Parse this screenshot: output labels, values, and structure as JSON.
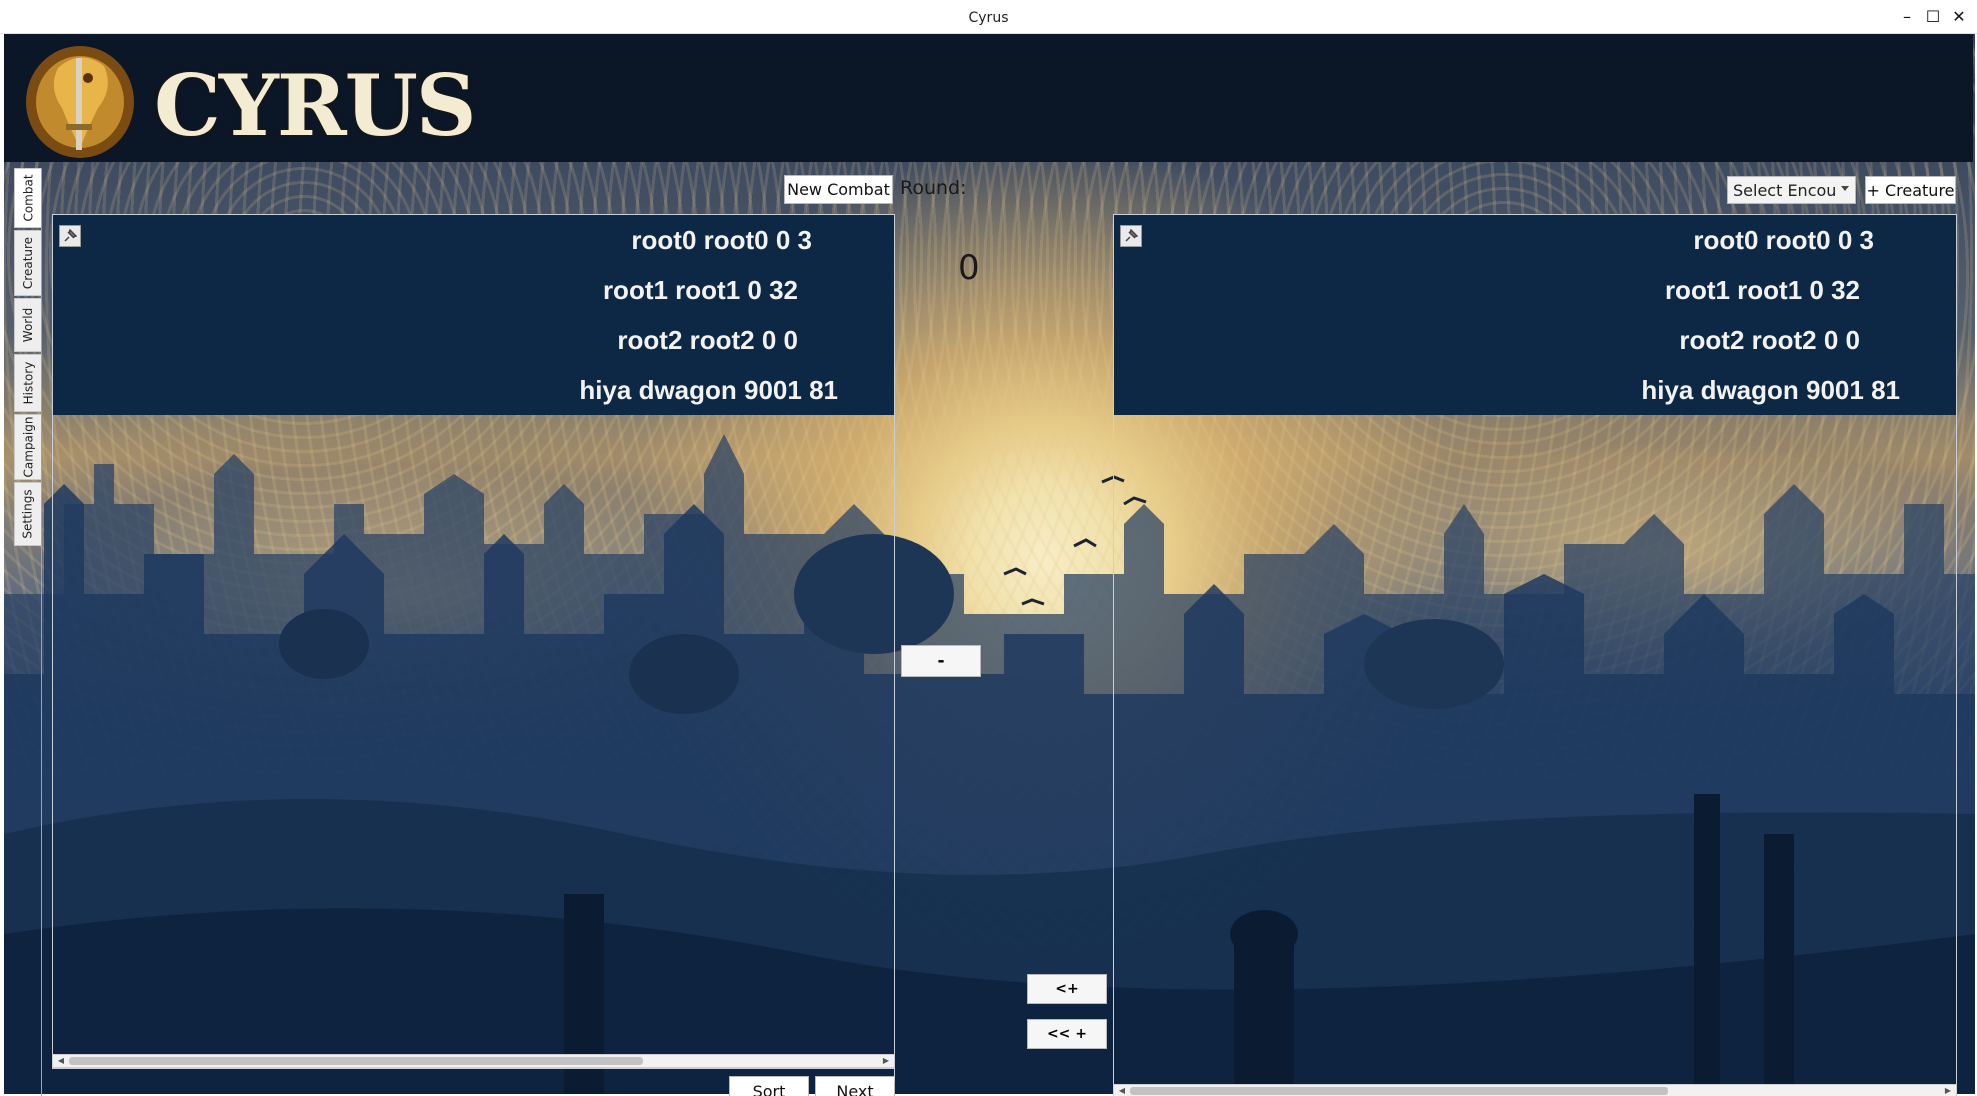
{
  "window": {
    "title": "Cyrus",
    "controls": {
      "minimize": "–",
      "maximize": "☐",
      "close": "✕"
    }
  },
  "header": {
    "logo_text": "CYRUS"
  },
  "sidebar": {
    "tabs": [
      {
        "label": "Combat",
        "active": true
      },
      {
        "label": "Creature",
        "active": false
      },
      {
        "label": "World",
        "active": false
      },
      {
        "label": "History",
        "active": false
      },
      {
        "label": "Campaign",
        "active": false
      },
      {
        "label": "Settings",
        "active": false
      }
    ]
  },
  "toolbar": {
    "new_combat_label": "New Combat",
    "round_label": "Round:",
    "round_value": "0",
    "select_encounter_value": "Select Encou",
    "add_creature_label": "+ Creature"
  },
  "left_panel": {
    "rows": [
      "root0 root0 0 3",
      "root1 root1 0 32",
      "root2 root2 0 0",
      "hiya dwagon 9001 81"
    ],
    "sort_label": "Sort",
    "next_label": "Next"
  },
  "right_panel": {
    "rows": [
      "root0 root0 0 3",
      "root1 root1 0 32",
      "root2 root2 0 0",
      "hiya dwagon 9001 81"
    ]
  },
  "center": {
    "minus_label": "-",
    "move_left_label": "<+",
    "move_all_left_label": "<< +"
  }
}
